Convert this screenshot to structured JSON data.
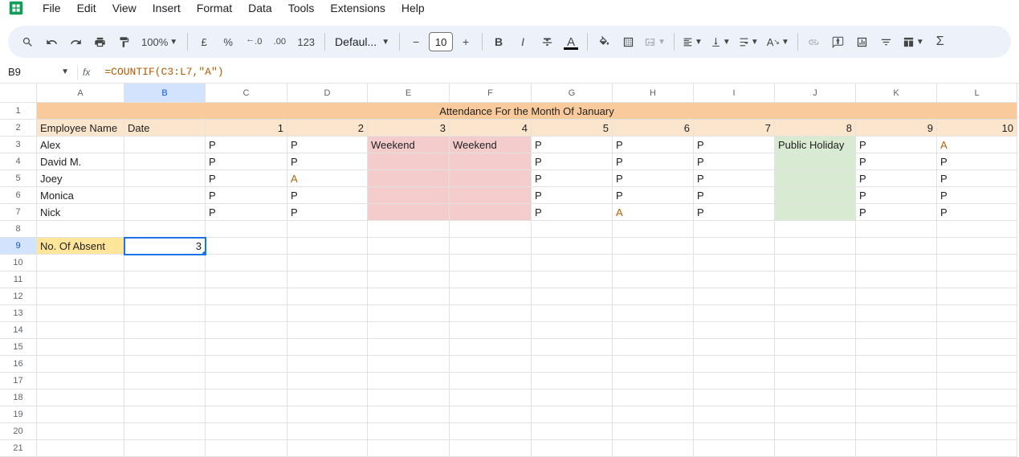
{
  "menu": {
    "items": [
      "File",
      "Edit",
      "View",
      "Insert",
      "Format",
      "Data",
      "Tools",
      "Extensions",
      "Help"
    ]
  },
  "toolbar": {
    "zoom": "100%",
    "currency": "£",
    "percent": "%",
    "dec_dec": ".0",
    "dec_inc": ".00",
    "numformat": "123",
    "font": "Defaul...",
    "fontsize": "10",
    "bold": "B",
    "italic": "I"
  },
  "namebox": "B9",
  "formula": "=COUNTIF(C3:L7,\"A\")",
  "columns": [
    "A",
    "B",
    "C",
    "D",
    "E",
    "F",
    "G",
    "H",
    "I",
    "J",
    "K",
    "L"
  ],
  "rows": [
    "1",
    "2",
    "3",
    "4",
    "5",
    "6",
    "7",
    "8",
    "9",
    "10",
    "11",
    "12",
    "13",
    "14",
    "15",
    "16",
    "17",
    "18",
    "19",
    "20",
    "21"
  ],
  "data": {
    "title": "Attendance For the Month Of January",
    "h_emp": "Employee Name",
    "h_date": "Date",
    "dates": [
      "1",
      "2",
      "3",
      "4",
      "5",
      "6",
      "7",
      "8",
      "9",
      "10"
    ],
    "weekend": "Weekend",
    "holiday": "Public Holiday",
    "employees": [
      {
        "name": "Alex",
        "att": [
          "P",
          "P",
          "",
          "",
          "P",
          "P",
          "P",
          "",
          "P",
          "A"
        ]
      },
      {
        "name": "David M.",
        "att": [
          "P",
          "P",
          "",
          "",
          "P",
          "P",
          "P",
          "",
          "P",
          "P"
        ]
      },
      {
        "name": "Joey",
        "att": [
          "P",
          "A",
          "",
          "",
          "P",
          "P",
          "P",
          "",
          "P",
          "P"
        ]
      },
      {
        "name": "Monica",
        "att": [
          "P",
          "P",
          "",
          "",
          "P",
          "P",
          "P",
          "",
          "P",
          "P"
        ]
      },
      {
        "name": "Nick",
        "att": [
          "P",
          "P",
          "",
          "",
          "P",
          "A",
          "P",
          "",
          "P",
          "P"
        ]
      }
    ],
    "absent_label": "No. Of Absent",
    "absent_count": "3"
  }
}
